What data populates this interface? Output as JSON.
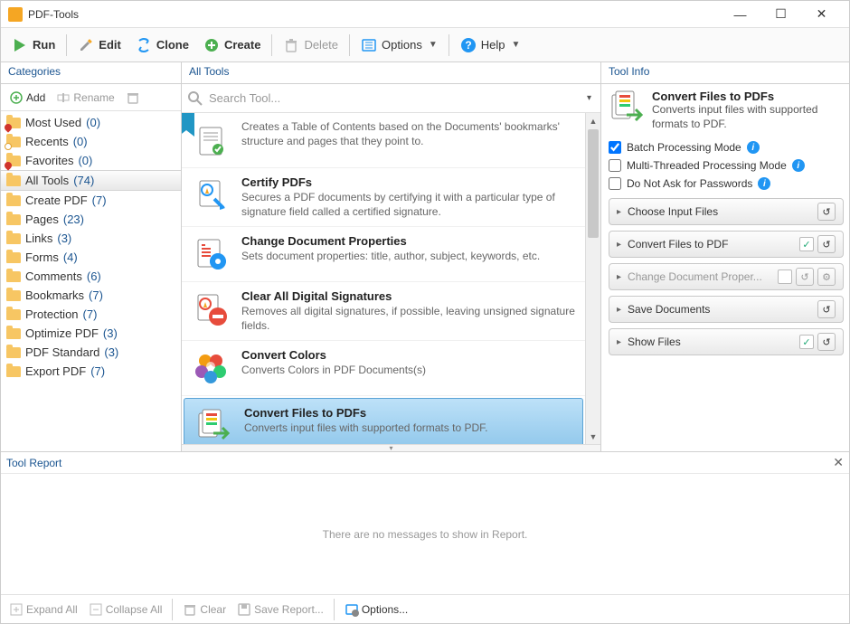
{
  "window": {
    "title": "PDF-Tools"
  },
  "toolbar": {
    "run": "Run",
    "edit": "Edit",
    "clone": "Clone",
    "create": "Create",
    "delete": "Delete",
    "options": "Options",
    "help": "Help"
  },
  "categories": {
    "header": "Categories",
    "add": "Add",
    "rename": "Rename",
    "items": [
      {
        "label": "Most Used",
        "count": 0,
        "badge": "heart"
      },
      {
        "label": "Recents",
        "count": 0,
        "badge": "clock"
      },
      {
        "label": "Favorites",
        "count": 0,
        "badge": "heart"
      },
      {
        "label": "All Tools",
        "count": 74,
        "selected": true
      },
      {
        "label": "Create PDF",
        "count": 7
      },
      {
        "label": "Pages",
        "count": 23
      },
      {
        "label": "Links",
        "count": 3
      },
      {
        "label": "Forms",
        "count": 4
      },
      {
        "label": "Comments",
        "count": 6
      },
      {
        "label": "Bookmarks",
        "count": 7
      },
      {
        "label": "Protection",
        "count": 7
      },
      {
        "label": "Optimize PDF",
        "count": 3
      },
      {
        "label": "PDF Standard",
        "count": 3
      },
      {
        "label": "Export PDF",
        "count": 7
      }
    ]
  },
  "alltools": {
    "header": "All Tools",
    "search_placeholder": "Search Tool...",
    "items": [
      {
        "title": "",
        "desc": "Creates a Table of Contents based on the Documents' bookmarks' structure and pages that they point to.",
        "ribbon": true
      },
      {
        "title": "Certify PDFs",
        "desc": "Secures a PDF documents by certifying it with a particular type of signature field called a certified signature."
      },
      {
        "title": "Change Document Properties",
        "desc": "Sets document properties: title, author, subject, keywords, etc."
      },
      {
        "title": "Clear All Digital Signatures",
        "desc": "Removes all digital signatures, if possible, leaving unsigned signature fields."
      },
      {
        "title": "Convert Colors",
        "desc": "Converts Colors in PDF Documents(s)"
      },
      {
        "title": "Convert Files to PDFs",
        "desc": "Converts input files with supported formats to PDF.",
        "selected": true
      }
    ]
  },
  "toolinfo": {
    "header": "Tool Info",
    "title": "Convert Files to PDFs",
    "desc": "Converts input files with supported formats to PDF.",
    "batch_label": "Batch Processing Mode",
    "multi_label": "Multi-Threaded Processing Mode",
    "nopass_label": "Do Not Ask for Passwords",
    "batch_checked": true,
    "multi_checked": false,
    "nopass_checked": false,
    "steps": [
      {
        "label": "Choose Input Files",
        "reset": true
      },
      {
        "label": "Convert Files to PDF",
        "checked": true,
        "reset": true
      },
      {
        "label": "Change Document Proper...",
        "disabled": true,
        "box": true,
        "reset": true,
        "gear": true
      },
      {
        "label": "Save Documents",
        "reset": true
      },
      {
        "label": "Show Files",
        "checked": true,
        "reset": true
      }
    ]
  },
  "report": {
    "header": "Tool Report",
    "empty": "There are no messages to show in Report.",
    "expand": "Expand All",
    "collapse": "Collapse All",
    "clear": "Clear",
    "save": "Save Report...",
    "options": "Options..."
  }
}
